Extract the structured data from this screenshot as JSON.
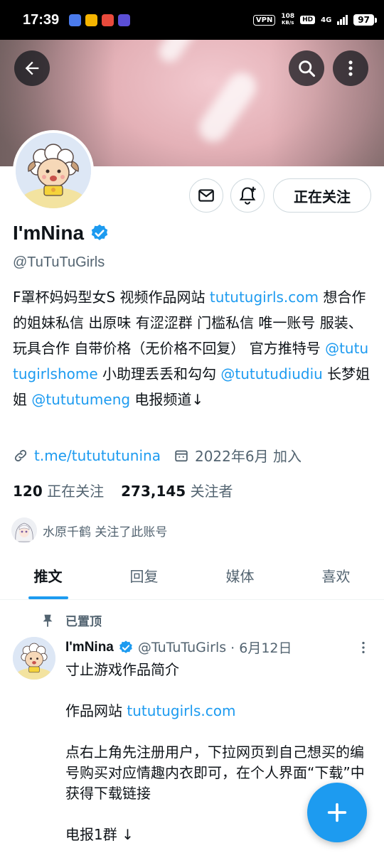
{
  "status_bar": {
    "time": "17:39",
    "vpn": "VPN",
    "speed_value": "108",
    "speed_unit": "KB/s",
    "hd": "HD",
    "network": "4G",
    "battery": "97",
    "app_icon_colors": [
      "#4b7bec",
      "#f5b400",
      "#e84a3c",
      "#5b4fd6"
    ]
  },
  "header": {
    "back_icon": "arrow-left-icon",
    "search_icon": "search-icon",
    "more_icon": "more-vertical-icon"
  },
  "profile": {
    "name": "I'mNina",
    "verified_icon": "verified-badge-icon",
    "handle": "@TuTuTuGirls",
    "bio": {
      "t1": "F罩杯妈妈型女S 视频作品网站 ",
      "link1": "tututugirls.com",
      "t2": " 想合作的姐妹私信 出原味 有涩涩群 门槛私信 唯一账号 服装、玩具合作 自带价格（无价格不回复） 官方推特号 ",
      "link2": "@tututugirlshome",
      "t3": " 小助理丢丢和勾勾 ",
      "link3": "@tututudiudiu",
      "t4": "  长梦姐姐 ",
      "link4": "@tututumeng",
      "t5": "  电报频道↓"
    },
    "website": "t.me/tutututunina",
    "joined": "2022年6月 加入",
    "following_count": "120",
    "following_label": "正在关注",
    "followers_count": "273,145",
    "followers_label": "关注者",
    "followed_by": "水原千鹤 关注了此账号"
  },
  "actions": {
    "message_icon": "mail-icon",
    "notify_icon": "bell-plus-icon",
    "follow_label": "正在关注"
  },
  "tabs": [
    {
      "label": "推文",
      "active": true
    },
    {
      "label": "回复",
      "active": false
    },
    {
      "label": "媒体",
      "active": false
    },
    {
      "label": "喜欢",
      "active": false
    }
  ],
  "pinned_tweet": {
    "pinned_label": "已置顶",
    "name": "I'mNina",
    "handle": "@TuTuTuGirls",
    "date": "· 6月12日",
    "line1": "寸止游戏作品简介",
    "line2_prefix": "作品网站  ",
    "line2_link": "tututugirls.com",
    "line3": "点右上角先注册用户，下拉网页到自己想买的编号购买对应情趣内衣即可，在个人界面“下载”中获得下载链接",
    "line4": "电报1群 ↓"
  },
  "fab": {
    "icon": "plus-icon"
  },
  "colors": {
    "accent": "#1d9bf0",
    "text": "#0f1419",
    "secondary": "#536471"
  }
}
